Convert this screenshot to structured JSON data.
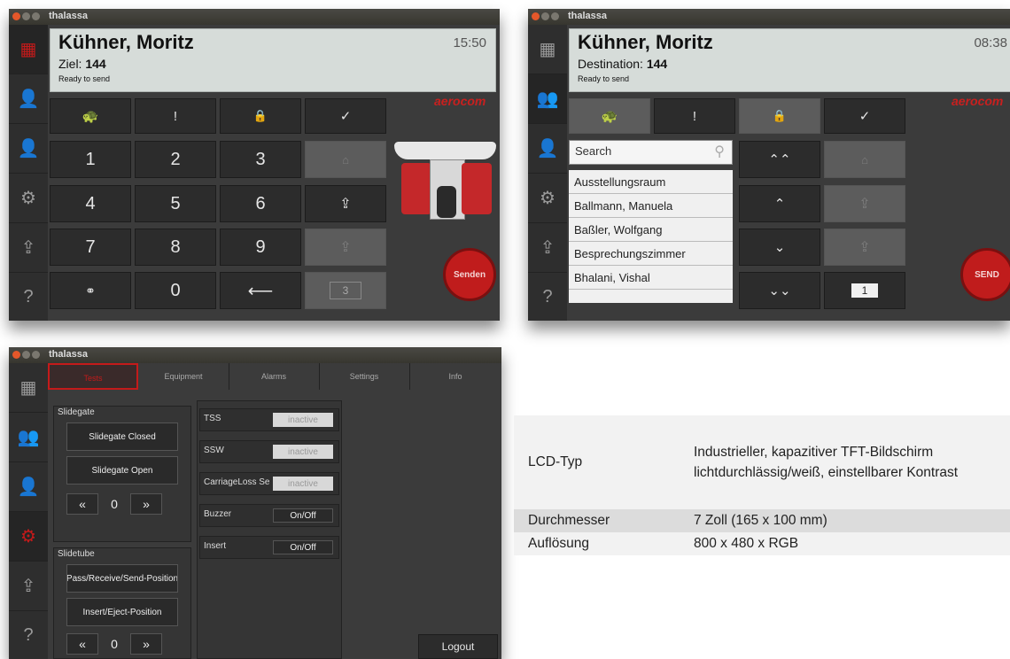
{
  "window_title": "thalassa",
  "screen1": {
    "name": "Kühner, Moritz",
    "time": "15:50",
    "dest_label": "Ziel:",
    "dest_value": "144",
    "status": "Ready to send",
    "brand": "aerocom",
    "keys": [
      "1",
      "2",
      "3",
      "4",
      "5",
      "6",
      "7",
      "8",
      "9",
      "0"
    ],
    "exclaim": "!",
    "counter": "3",
    "send": "Senden"
  },
  "screen2": {
    "name": "Kühner, Moritz",
    "time": "08:38",
    "dest_label": "Destination:",
    "dest_value": "144",
    "status": "Ready to send",
    "brand": "aerocom",
    "exclaim": "!",
    "search_placeholder": "Search",
    "list": [
      "Ausstellungsraum",
      "Ballmann, Manuela",
      "Baßler, Wolfgang",
      "Besprechungszimmer",
      "Bhalani, Vishal"
    ],
    "counter": "1",
    "send": "SEND"
  },
  "screen3": {
    "tabs": [
      "Tests",
      "Equipment",
      "Alarms",
      "Settings",
      "Info"
    ],
    "slidegate": {
      "title": "Slidegate",
      "btn1": "Slidegate Closed",
      "btn2": "Slidegate Open",
      "value": "0"
    },
    "slidetube": {
      "title": "Slidetube",
      "btn1": "Pass/Receive/Send-Position",
      "btn2": "Insert/Eject-Position",
      "value": "0"
    },
    "stepper_left": "«",
    "stepper_right": "»",
    "io": [
      {
        "label": "TSS",
        "value": "inactive"
      },
      {
        "label": "SSW",
        "value": "inactive"
      },
      {
        "label": "CarriageLoss Sensor",
        "value": "inactive"
      },
      {
        "label": "Buzzer",
        "value": "On/Off"
      },
      {
        "label": "Insert",
        "value": "On/Off"
      }
    ],
    "logout": "Logout"
  },
  "spec": [
    {
      "key": "LCD-Typ",
      "value": "Industrieller, kapazitiver TFT-Bildschirm lichtdurchlässig/weiß, einstellbarer Kontrast"
    },
    {
      "key": "Durchmesser",
      "value": "7 Zoll (165 x 100 mm)"
    },
    {
      "key": "Auflösung",
      "value": "800 x 480 x RGB"
    }
  ],
  "colors": {
    "accent": "#c8201f",
    "header_bg": "#d6dcd9",
    "panel_bg": "#3b3b3b"
  }
}
